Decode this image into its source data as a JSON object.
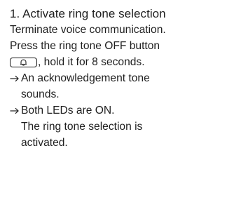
{
  "section": {
    "heading": "1. Activate ring tone selection"
  },
  "instructions": {
    "line1": "Terminate voice communication.",
    "line2": "Press the ring tone OFF button",
    "line3_after_button": ", hold it for 8 seconds."
  },
  "results": [
    {
      "line_a": "An acknowledgement tone",
      "line_b": "sounds."
    },
    {
      "line_a": "Both LEDs are ON.",
      "line_b": "The ring tone selection is",
      "line_c": "activated."
    }
  ],
  "icons": {
    "button_icon": "ring-tone-off-button-icon",
    "arrow_icon": "arrow-right-icon"
  }
}
